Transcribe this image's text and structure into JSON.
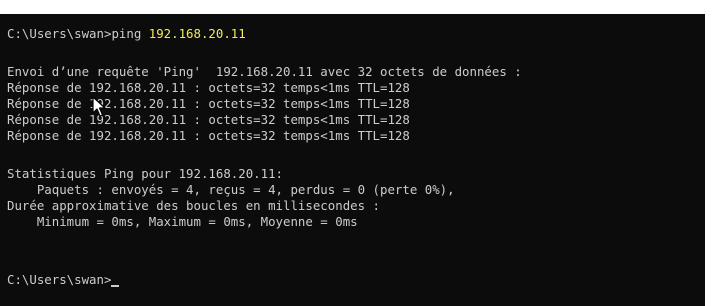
{
  "console": {
    "prompt_path": "C:\\Users\\swan>",
    "command": "ping ",
    "command_arg": "192.168.20.11",
    "lines": {
      "envoi": "Envoi d’une requête 'Ping'  192.168.20.11 avec 32 octets de données :",
      "reply1": "Réponse de 192.168.20.11 : octets=32 temps<1ms TTL=128",
      "reply2": "Réponse de 192.168.20.11 : octets=32 temps<1ms TTL=128",
      "reply3": "Réponse de 192.168.20.11 : octets=32 temps<1ms TTL=128",
      "reply4": "Réponse de 192.168.20.11 : octets=32 temps<1ms TTL=128",
      "stats_title": "Statistiques Ping pour 192.168.20.11:",
      "stats_packets": "    Paquets : envoyés = 4, reçus = 4, perdus = 0 (perte 0%),",
      "rtt_title": "Durée approximative des boucles en millisecondes :",
      "rtt_values": "    Minimum = 0ms, Maximum = 0ms, Moyenne = 0ms"
    },
    "final_prompt": "C:\\Users\\swan>"
  },
  "colors": {
    "background": "#0c0c0c",
    "text": "#cccccc",
    "highlight": "#f3ec58"
  },
  "icons": {
    "pointer": "mouse-pointer-icon"
  }
}
